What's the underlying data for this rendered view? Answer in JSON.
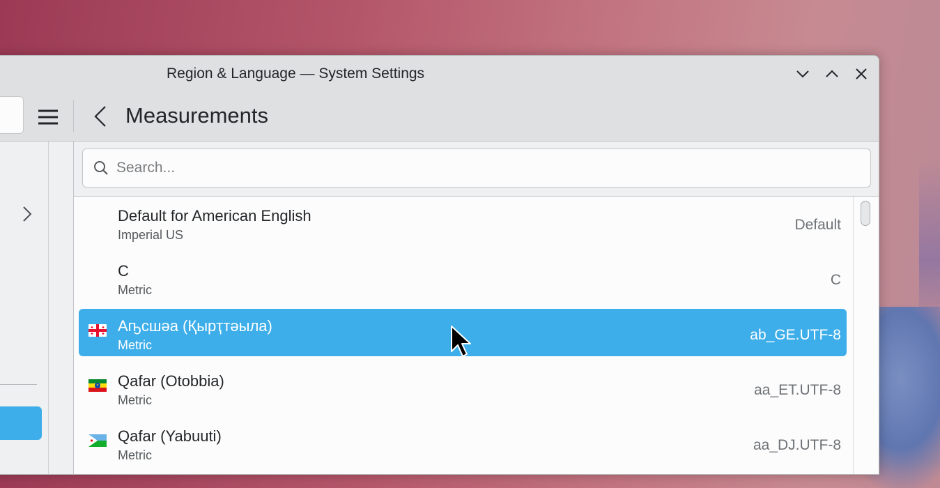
{
  "window": {
    "title": "Region & Language — System Settings"
  },
  "header": {
    "page_title": "Measurements"
  },
  "search": {
    "placeholder": "Search..."
  },
  "list": {
    "items": [
      {
        "name": "Default for American English",
        "sub": "Imperial US",
        "code": "Default",
        "flag": "none",
        "selected": false
      },
      {
        "name": "C",
        "sub": "Metric",
        "code": "C",
        "flag": "none",
        "selected": false
      },
      {
        "name": "Аҧсшәа (Қырҭтәыла)",
        "sub": "Metric",
        "code": "ab_GE.UTF-8",
        "flag": "georgia-flag",
        "selected": true
      },
      {
        "name": "Qafar (Otobbia)",
        "sub": "Metric",
        "code": "aa_ET.UTF-8",
        "flag": "ethiopia-flag",
        "selected": false
      },
      {
        "name": "Qafar (Yabuuti)",
        "sub": "Metric",
        "code": "aa_DJ.UTF-8",
        "flag": "djibouti-flag",
        "selected": false
      }
    ]
  },
  "colors": {
    "accent": "#3daee9",
    "window_bg": "#eff0f1",
    "header_bg": "#dee0e2"
  }
}
